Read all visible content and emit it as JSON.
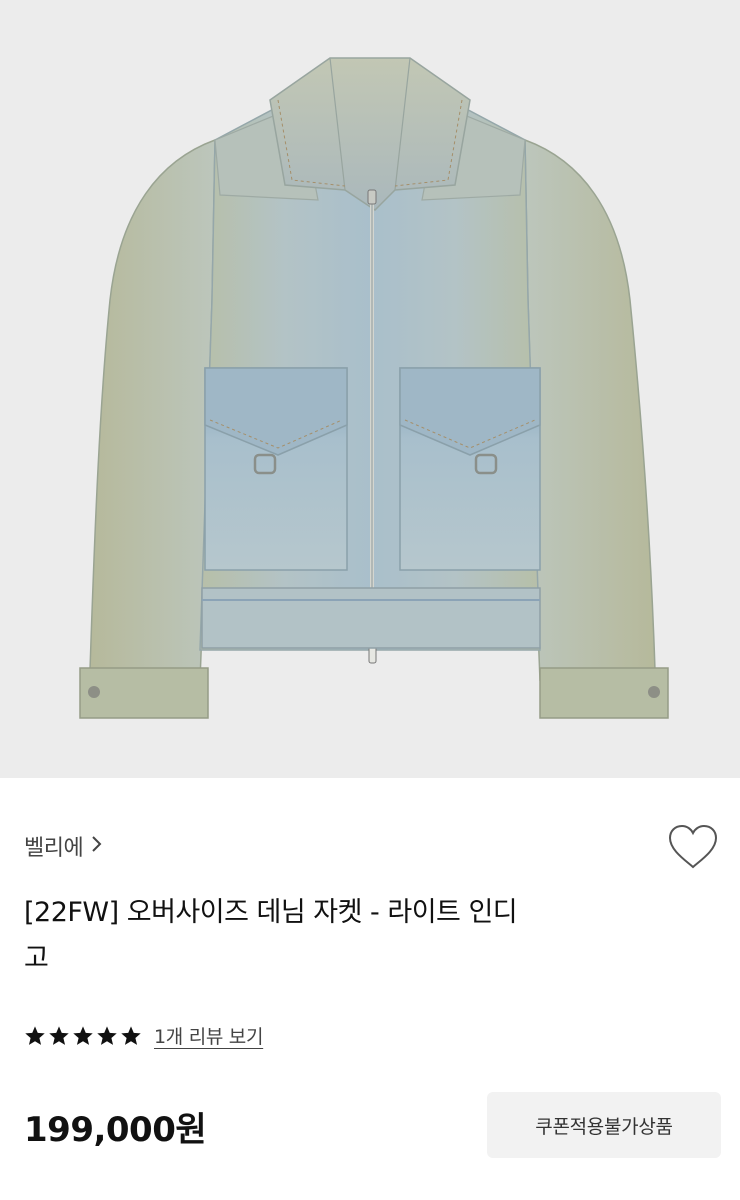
{
  "product": {
    "image_alt": "oversize denim jacket light indigo",
    "brand": "벨리에",
    "title_line1": "[22FW] 오버사이즈 데님 자켓 - 라이트 인디",
    "title_line2": "고",
    "rating_stars": 5,
    "rating_max": 5,
    "review_link": "1개 리뷰 보기",
    "price": "199,000원",
    "coupon_badge": "쿠폰적용불가상품"
  },
  "icons": {
    "brand_chevron": "chevron-right-icon",
    "wishlist": "heart-outline-icon",
    "star": "star-filled-icon"
  },
  "colors": {
    "image_background": "#ececec",
    "denim_light": "#b9c6c6",
    "denim_dark": "#8fa6b0",
    "star": "#111111",
    "badge_background": "#f2f2f2"
  }
}
